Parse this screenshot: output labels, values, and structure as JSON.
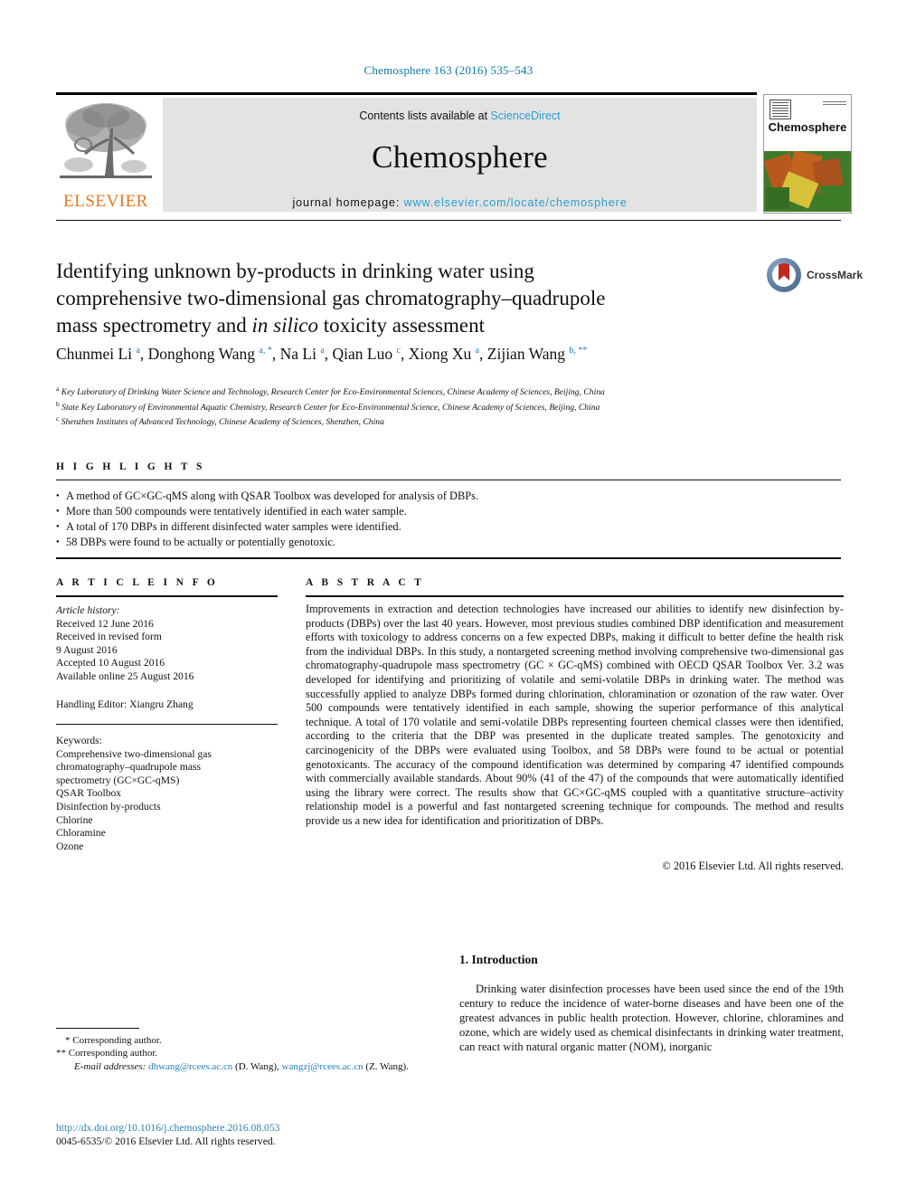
{
  "running_head": "Chemosphere 163 (2016) 535–543",
  "masthead": {
    "contents_prefix": "Contents lists available at ",
    "contents_link": "ScienceDirect",
    "journal_title": "Chemosphere",
    "homepage_prefix": "journal homepage: ",
    "homepage_url": "www.elsevier.com/locate/chemosphere",
    "publisher": "ELSEVIER",
    "cover_title": "Chemosphere"
  },
  "article": {
    "title_line1": "Identifying unknown by-products in drinking water using",
    "title_line2": "comprehensive two-dimensional gas chromatography–quadrupole",
    "title_line3_a": "mass spectrometry and ",
    "title_line3_italic": "in silico",
    "title_line3_b": " toxicity assessment",
    "crossmark_label": "CrossMark",
    "authors": "Chunmei Li a, Donghong Wang a, *, Na Li a, Qian Luo c, Xiong Xu a, Zijian Wang b, **",
    "affiliations": [
      "Key Laboratory of Drinking Water Science and Technology, Research Center for Eco-Environmental Sciences, Chinese Academy of Sciences, Beijing, China",
      "State Key Laboratory of Environmental Aquatic Chemistry, Research Center for Eco-Environmental Science, Chinese Academy of Sciences, Beijing, China",
      "Shenzhen Institutes of Advanced Technology, Chinese Academy of Sciences, Shenzhen, China"
    ],
    "affiliation_marks": [
      "a",
      "b",
      "c"
    ]
  },
  "highlights": {
    "heading": "H I G H L I G H T S",
    "items": [
      "A method of GC×GC-qMS along with QSAR Toolbox was developed for analysis of DBPs.",
      "More than 500 compounds were tentatively identified in each water sample.",
      "A total of 170 DBPs in different disinfected water samples were identified.",
      "58 DBPs were found to be actually or potentially genotoxic."
    ]
  },
  "article_info": {
    "heading": "A R T I C L E  I N F O",
    "history_label": "Article history:",
    "history_lines": [
      "Received 12 June 2016",
      "Received in revised form",
      "9 August 2016",
      "Accepted 10 August 2016",
      "Available online 25 August 2016"
    ],
    "handling_editor": "Handling Editor: Xiangru Zhang",
    "keywords_label": "Keywords:",
    "keywords": [
      "Comprehensive two-dimensional gas",
      "chromatography–quadrupole mass",
      "spectrometry (GC×GC-qMS)",
      "QSAR Toolbox",
      "Disinfection by-products",
      "Chlorine",
      "Chloramine",
      "Ozone"
    ]
  },
  "abstract": {
    "heading": "A B S T R A C T",
    "text": "Improvements in extraction and detection technologies have increased our abilities to identify new disinfection by-products (DBPs) over the last 40 years. However, most previous studies combined DBP identification and measurement efforts with toxicology to address concerns on a few expected DBPs, making it difficult to better define the health risk from the individual DBPs. In this study, a nontargeted screening method involving comprehensive two-dimensional gas chromatography-quadrupole mass spectrometry (GC × GC-qMS) combined with OECD QSAR Toolbox Ver. 3.2 was developed for identifying and prioritizing of volatile and semi-volatile DBPs in drinking water. The method was successfully applied to analyze DBPs formed during chlorination, chloramination or ozonation of the raw water. Over 500 compounds were tentatively identified in each sample, showing the superior performance of this analytical technique. A total of 170 volatile and semi-volatile DBPs representing fourteen chemical classes were then identified, according to the criteria that the DBP was presented in the duplicate treated samples. The genotoxicity and carcinogenicity of the DBPs were evaluated using Toolbox, and 58 DBPs were found to be actual or potential genotoxicants. The accuracy of the compound identification was determined by comparing 47 identified compounds with commercially available standards. About 90% (41 of the 47) of the compounds that were automatically identified using the library were correct. The results show that GC×GC-qMS coupled with a quantitative structure–activity relationship model is a powerful and fast nontargeted screening technique for compounds. The method and results provide us a new idea for identification and prioritization of DBPs.",
    "copyright": "© 2016 Elsevier Ltd. All rights reserved."
  },
  "introduction": {
    "heading": "1. Introduction",
    "text": "Drinking water disinfection processes have been used since the end of the 19th century to reduce the incidence of water-borne diseases and have been one of the greatest advances in public health protection. However, chlorine, chloramines and ozone, which are widely used as chemical disinfectants in drinking water treatment, can react with natural organic matter (NOM), inorganic"
  },
  "footnotes": {
    "corresponding_1": "* Corresponding author.",
    "corresponding_2": "** Corresponding author.",
    "email_label": "E-mail addresses:",
    "email_1": "dhwang@rcees.ac.cn",
    "email_1_who": "(D. Wang),",
    "email_2": "wangzj@rcees.ac.cn",
    "email_2_who": "(Z. Wang).",
    "doi": "http://dx.doi.org/10.1016/j.chemosphere.2016.08.053",
    "issn_line": "0045-6535/© 2016 Elsevier Ltd. All rights reserved."
  },
  "colors": {
    "link": "#2a7fb8",
    "running_head": "#0b7aa8",
    "elsevier_orange": "#e87722",
    "masthead_bg": "#e3e3e3",
    "crossmark_red": "#c0281c"
  }
}
